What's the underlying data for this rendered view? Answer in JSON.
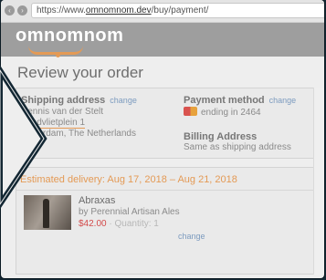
{
  "browser": {
    "url_prefix": "https://www.",
    "url_domain": "omnomnom.dev",
    "url_path": "/buy/payment/"
  },
  "site": {
    "logo_text": "omnomnom",
    "brand_color": "#e49a55"
  },
  "page": {
    "title": "Review your order"
  },
  "shipping": {
    "label": "Shipping address",
    "change_label": "change",
    "lines": [
      "Dennis van der Stelt",
      "Zandvlietplein 1",
      "Rotterdam, The Netherlands"
    ]
  },
  "payment": {
    "label": "Payment method",
    "change_label": "change",
    "card_text": "ending in 2464"
  },
  "billing": {
    "label": "Billing Address",
    "value": "Same as shipping address"
  },
  "delivery": {
    "text": "Estimated delivery: Aug 17, 2018 – Aug 21, 2018"
  },
  "product": {
    "name": "Abraxas",
    "brand": "by Perennial Artisan Ales",
    "price": "$42.00",
    "quantity": " · Quantity: 1",
    "change_label": "change"
  }
}
